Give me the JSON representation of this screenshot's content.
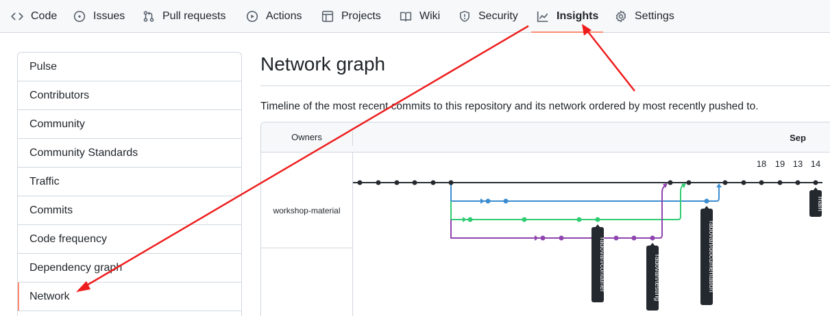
{
  "nav": {
    "tabs": [
      {
        "label": "Code",
        "icon": "code-icon"
      },
      {
        "label": "Issues",
        "icon": "issue-icon"
      },
      {
        "label": "Pull requests",
        "icon": "pull-request-icon"
      },
      {
        "label": "Actions",
        "icon": "play-icon"
      },
      {
        "label": "Projects",
        "icon": "table-icon"
      },
      {
        "label": "Wiki",
        "icon": "book-icon"
      },
      {
        "label": "Security",
        "icon": "shield-icon"
      },
      {
        "label": "Insights",
        "icon": "graph-icon",
        "selected": true
      },
      {
        "label": "Settings",
        "icon": "gear-icon"
      }
    ]
  },
  "sidebar": {
    "items": [
      {
        "label": "Pulse"
      },
      {
        "label": "Contributors"
      },
      {
        "label": "Community"
      },
      {
        "label": "Community Standards"
      },
      {
        "label": "Traffic"
      },
      {
        "label": "Commits"
      },
      {
        "label": "Code frequency"
      },
      {
        "label": "Dependency graph"
      },
      {
        "label": "Network",
        "selected": true
      }
    ]
  },
  "page": {
    "title": "Network graph",
    "description": "Timeline of the most recent commits to this repository and its network ordered by most recently pushed to."
  },
  "graph": {
    "owners_label": "Owners",
    "owner": "workshop-material",
    "month": "Sep",
    "days": [
      "18",
      "19",
      "13",
      "14"
    ],
    "branch_labels": [
      "main",
      "radovan/container",
      "radovan/testing",
      "radovan/documentation"
    ],
    "colors": {
      "main": "#24292f",
      "documentation": "#3b8dd0",
      "container": "#2ecc71",
      "testing": "#8e44ad",
      "accent": "#fd8c73",
      "annotation": "#ee1c1c"
    }
  }
}
